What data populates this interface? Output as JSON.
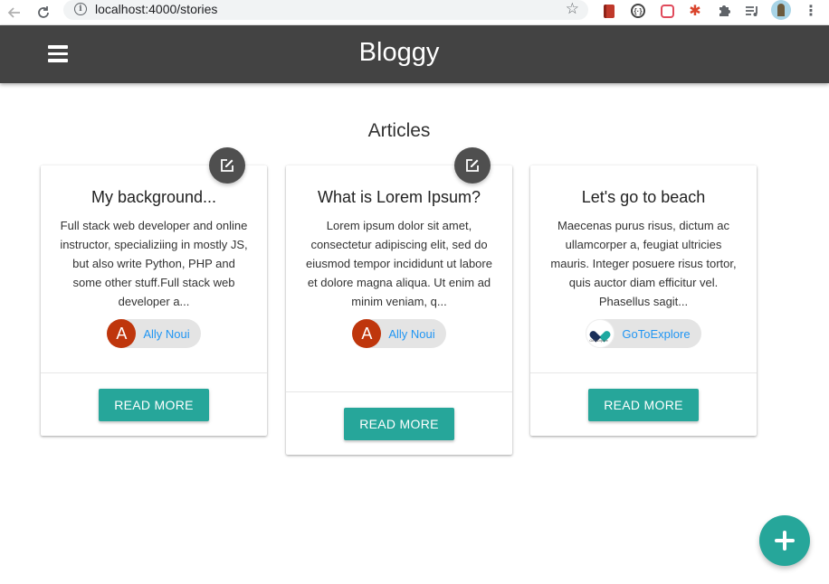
{
  "browser": {
    "url": "localhost:4000/stories",
    "icons": [
      "back-arrow-icon",
      "reload-icon",
      "info-icon",
      "star-icon",
      "extensions",
      "profile-avatar",
      "menu-dots-icon"
    ]
  },
  "app": {
    "title": "Bloggy",
    "menu_icon": "hamburger-menu-icon",
    "primary_color": "#434343",
    "accent_color": "#26a69a"
  },
  "main": {
    "section_title": "Articles",
    "cards": [
      {
        "title": "My background...",
        "body": "Full stack web developer and online instructor, specializiing in mostly JS, but also write Python, PHP and some other stuff.Full stack web developer a...",
        "author": "Ally Noui",
        "avatar_letter": "A",
        "editable": true,
        "action_label": "Read More"
      },
      {
        "title": "What is Lorem Ipsum?",
        "body": "Lorem ipsum dolor sit amet, consectetur adipiscing elit, sed do eiusmod tempor incididunt ut labore et dolore magna aliqua. Ut enim ad minim veniam, q...",
        "author": "Ally Noui",
        "avatar_letter": "A",
        "editable": true,
        "action_label": "Read More"
      },
      {
        "title": "Let's go to beach",
        "body": "Maecenas purus risus, dictum ac ullamcorper a, feugiat ultricies mauris. Integer posuere risus tortor, quis auctor diam efficitur vel. Phasellus sagit...",
        "author": "GoToExplore",
        "avatar_logo_text": "GoToExplore",
        "editable": false,
        "action_label": "Read More"
      }
    ]
  },
  "add_button_icon": "plus-icon"
}
